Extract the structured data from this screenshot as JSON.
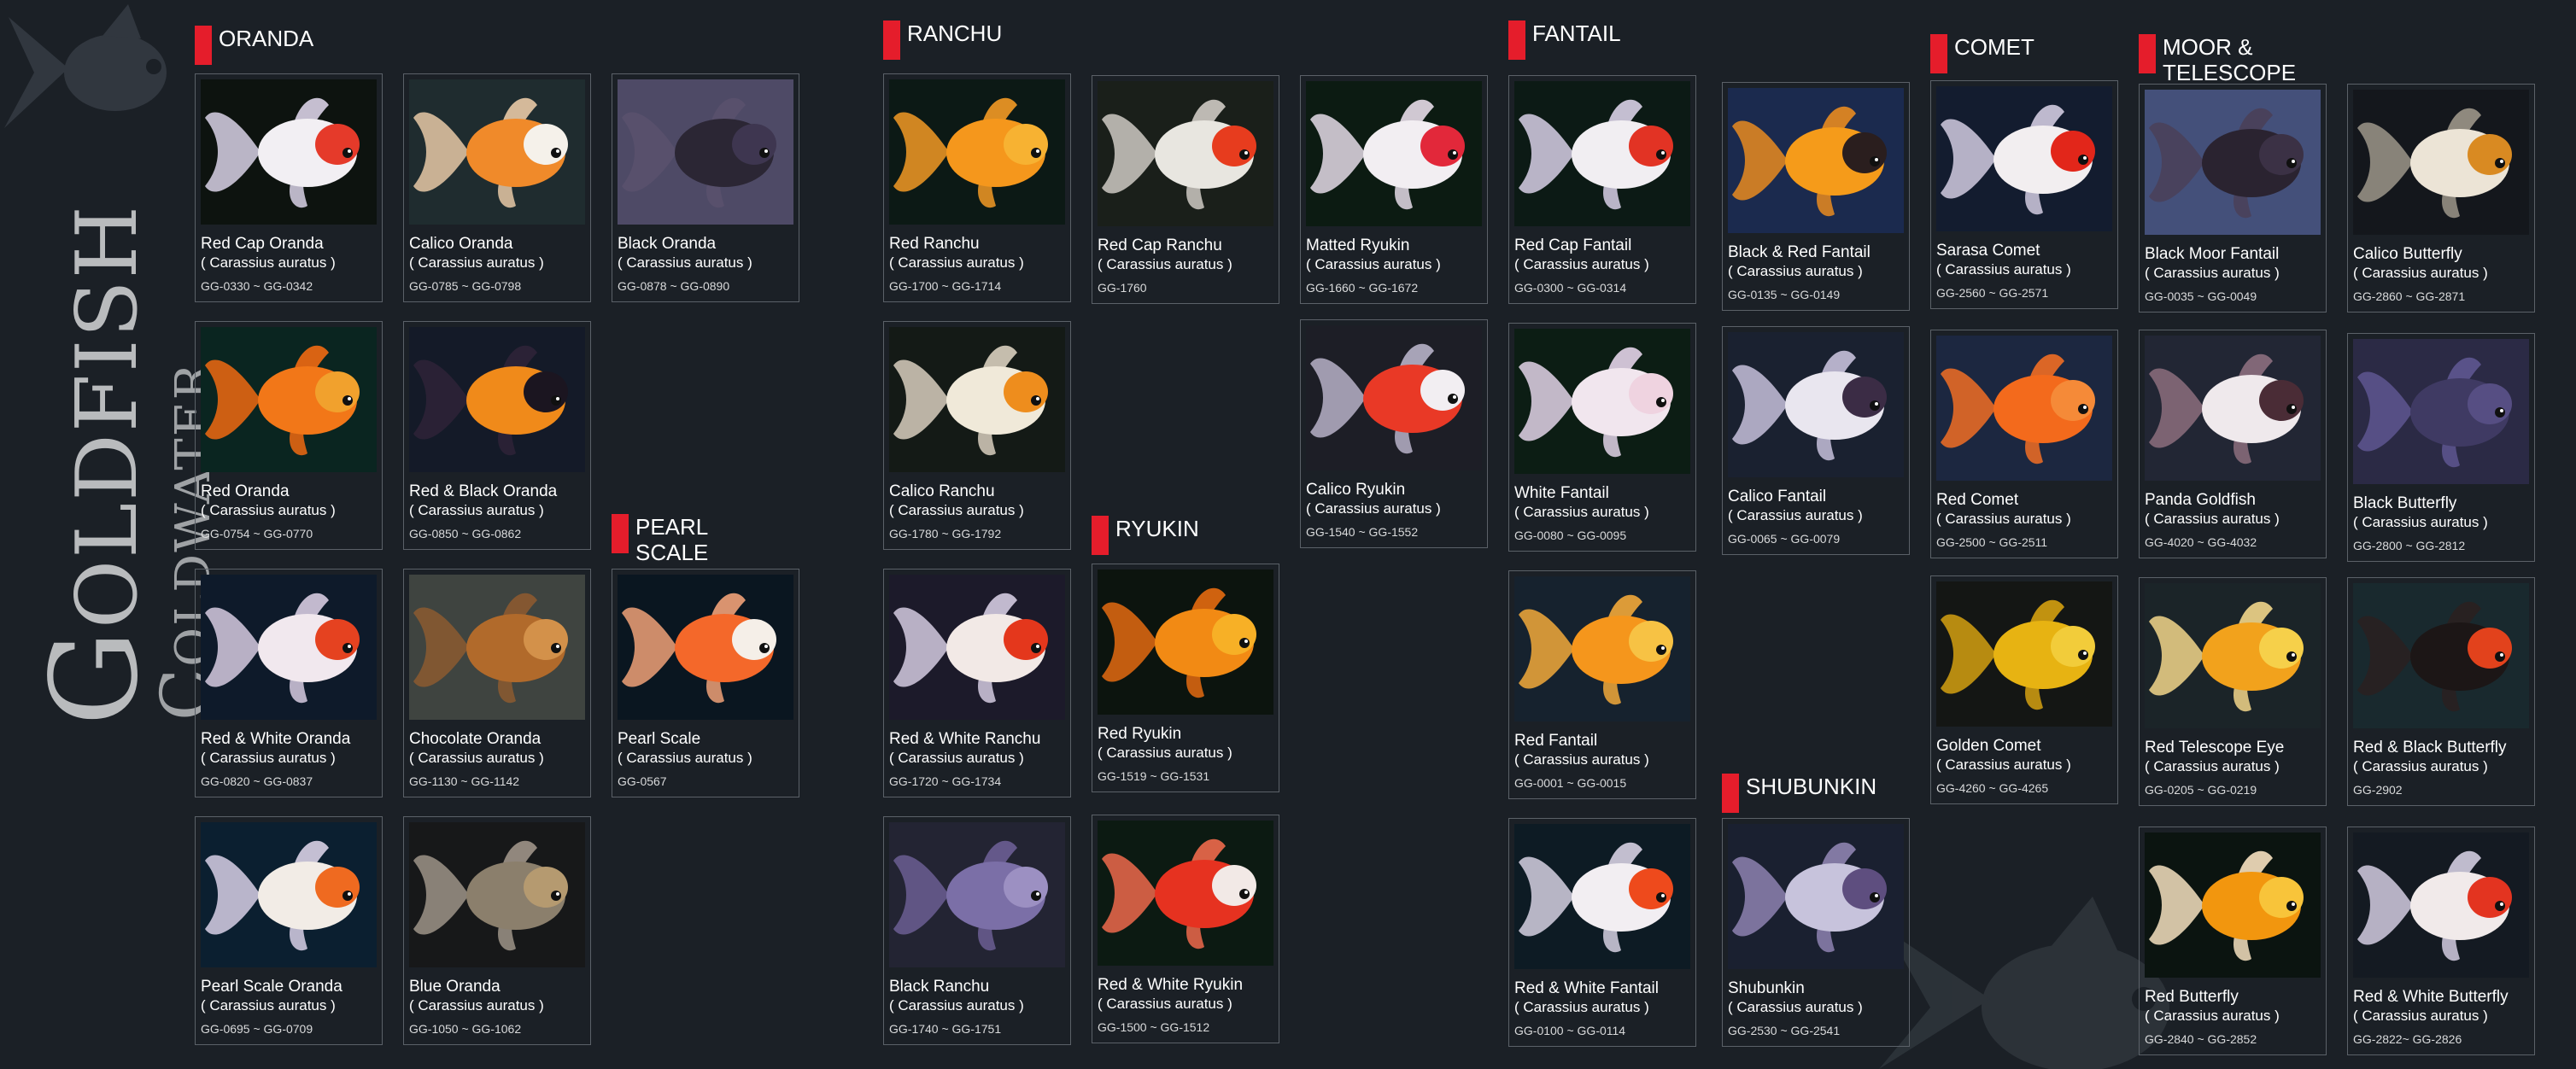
{
  "title": {
    "main": "Goldfish",
    "sub": "Coldwater"
  },
  "theme": {
    "background": "#1b2026",
    "accent": "#e51d2b",
    "card_border": "#5b6168"
  },
  "sections": [
    {
      "id": "oranda",
      "label": "ORANDA"
    },
    {
      "id": "pearl-scale",
      "label": "PEARL\nSCALE"
    },
    {
      "id": "ranchu",
      "label": "RANCHU"
    },
    {
      "id": "ryukin",
      "label": "RYUKIN"
    },
    {
      "id": "fantail",
      "label": "FANTAIL"
    },
    {
      "id": "shubunkin",
      "label": "SHUBUNKIN"
    },
    {
      "id": "comet",
      "label": "COMET"
    },
    {
      "id": "moor-telescope",
      "label": "MOOR &\nTELESCOPE"
    }
  ],
  "fish": [
    {
      "name": "Red Cap Oranda",
      "species": "( Carassius auratus )",
      "code": "GG-0330 ~ GG-0342",
      "photo_bg": "#0d130f",
      "body": "#f2eff3",
      "accent": "#e53a2a",
      "fin": "#d9d2e6"
    },
    {
      "name": "Calico Oranda",
      "species": "( Carassius auratus )",
      "code": "GG-0785 ~ GG-0798",
      "photo_bg": "#1f2c2f",
      "body": "#f08a2a",
      "accent": "#f5f1ea",
      "fin": "#e8c9a6"
    },
    {
      "name": "Black Oranda",
      "species": "( Carassius auratus )",
      "code": "GG-0878 ~ GG-0890",
      "photo_bg": "#4e4a66",
      "body": "#2b2634",
      "accent": "#3e3650",
      "fin": "#5a516d"
    },
    {
      "name": "Red Oranda",
      "species": "( Carassius auratus )",
      "code": "GG-0754 ~ GG-0770",
      "photo_bg": "#0a2520",
      "body": "#f27718",
      "accent": "#f1a12d",
      "fin": "#f06a12"
    },
    {
      "name": "Red & Black Oranda",
      "species": "( Carassius auratus )",
      "code": "GG-0850 ~ GG-0862",
      "photo_bg": "#141a28",
      "body": "#f08a1a",
      "accent": "#1b1520",
      "fin": "#2e2337"
    },
    {
      "name": "Red & White Oranda",
      "species": "( Carassius auratus )",
      "code": "GG-0820 ~ GG-0837",
      "photo_bg": "#0e1a2a",
      "body": "#f1e8ee",
      "accent": "#e54220",
      "fin": "#d6cbe0"
    },
    {
      "name": "Chocolate Oranda",
      "species": "( Carassius auratus )",
      "code": "GG-1130 ~ GG-1142",
      "photo_bg": "#3f4440",
      "body": "#b16a2b",
      "accent": "#d3914a",
      "fin": "#8c5a30"
    },
    {
      "name": "Pearl Scale",
      "species": "( Carassius auratus )",
      "code": "GG-0567",
      "photo_bg": "#0a1620",
      "body": "#f4682a",
      "accent": "#f5efe8",
      "fin": "#f0a178"
    },
    {
      "name": "Pearl Scale Oranda",
      "species": "( Carassius auratus )",
      "code": "GG-0695 ~ GG-0709",
      "photo_bg": "#0b1f30",
      "body": "#f2ece6",
      "accent": "#ef6a20",
      "fin": "#d8d0e6"
    },
    {
      "name": "Blue Oranda",
      "species": "( Carassius auratus )",
      "code": "GG-1050 ~ GG-1062",
      "photo_bg": "#171819",
      "body": "#8b7f6c",
      "accent": "#b59a70",
      "fin": "#9e9488"
    },
    {
      "name": "Red Ranchu",
      "species": "( Carassius auratus )",
      "code": "GG-1700 ~ GG-1714",
      "photo_bg": "#0c1915",
      "body": "#f5971c",
      "accent": "#f7b232",
      "fin": "#f39a25"
    },
    {
      "name": "Red Cap Ranchu",
      "species": "( Carassius auratus )",
      "code": "GG-1760",
      "photo_bg": "#1a1f1a",
      "body": "#e8e6e0",
      "accent": "#e73c1e",
      "fin": "#cfcac4"
    },
    {
      "name": "Matted Ryukin",
      "species": "( Carassius auratus )",
      "code": "GG-1660 ~ GG-1672",
      "photo_bg": "#0c1b12",
      "body": "#f2eef2",
      "accent": "#e2283a",
      "fin": "#e5dbe8"
    },
    {
      "name": "Calico Ranchu",
      "species": "( Carassius auratus )",
      "code": "GG-1780 ~ GG-1792",
      "photo_bg": "#141a16",
      "body": "#f0e9d9",
      "accent": "#ee8d1d",
      "fin": "#d8cfbe"
    },
    {
      "name": "Calico Ryukin",
      "species": "( Carassius auratus )",
      "code": "GG-1540 ~ GG-1552",
      "photo_bg": "#1d1e26",
      "body": "#e93926",
      "accent": "#f2eef2",
      "fin": "#b7b1c8"
    },
    {
      "name": "Red & White Ranchu",
      "species": "( Carassius auratus )",
      "code": "GG-1720 ~ GG-1734",
      "photo_bg": "#1c1a2a",
      "body": "#f2e9e6",
      "accent": "#e4371c",
      "fin": "#d4cbe0"
    },
    {
      "name": "Red Ryukin",
      "species": "( Carassius auratus )",
      "code": "GG-1519 ~ GG-1531",
      "photo_bg": "#0c140e",
      "body": "#f28a14",
      "accent": "#f7b026",
      "fin": "#e46a10"
    },
    {
      "name": "Black Ranchu",
      "species": "( Carassius auratus )",
      "code": "GG-1740 ~ GG-1751",
      "photo_bg": "#232433",
      "body": "#7b6fa7",
      "accent": "#9c90c2",
      "fin": "#6b5e93"
    },
    {
      "name": "Red & White Ryukin",
      "species": "( Carassius auratus )",
      "code": "GG-1500 ~ GG-1512",
      "photo_bg": "#0c1a12",
      "body": "#e63220",
      "accent": "#f2e9e6",
      "fin": "#ee6a4c"
    },
    {
      "name": "Red Cap Fantail",
      "species": "( Carassius auratus )",
      "code": "GG-0300 ~ GG-0314",
      "photo_bg": "#0c1a15",
      "body": "#f1eef2",
      "accent": "#e23324",
      "fin": "#d8d0e6"
    },
    {
      "name": "Black & Red Fantail",
      "species": "( Carassius auratus )",
      "code": "GG-0135 ~ GG-0149",
      "photo_bg": "#1b2a4e",
      "body": "#f59b1a",
      "accent": "#2a1e1e",
      "fin": "#e98b20"
    },
    {
      "name": "White Fantail",
      "species": "( Carassius auratus )",
      "code": "GG-0080 ~ GG-0095",
      "photo_bg": "#0c1d14",
      "body": "#f1e6ee",
      "accent": "#efd3e0",
      "fin": "#e3d4e8"
    },
    {
      "name": "Calico Fantail",
      "species": "( Carassius auratus )",
      "code": "GG-0065 ~ GG-0079",
      "photo_bg": "#1a2130",
      "body": "#e9e6ef",
      "accent": "#3b2c45",
      "fin": "#c7c0da"
    },
    {
      "name": "Red Fantail",
      "species": "( Carassius auratus )",
      "code": "GG-0001 ~ GG-0015",
      "photo_bg": "#16222e",
      "body": "#f5961c",
      "accent": "#f7c244",
      "fin": "#f2a93a"
    },
    {
      "name": "Red & White Fantail",
      "species": "( Carassius auratus )",
      "code": "GG-0100 ~ GG-0114",
      "photo_bg": "#0d1b24",
      "body": "#f2eef2",
      "accent": "#ee4a1c",
      "fin": "#d6d0e2"
    },
    {
      "name": "Shubunkin",
      "species": "( Carassius auratus )",
      "code": "GG-2530 ~ GG-2541",
      "photo_bg": "#1a2030",
      "body": "#c7c3dc",
      "accent": "#5e4e7f",
      "fin": "#8e83b0"
    },
    {
      "name": "Sarasa Comet",
      "species": "( Carassius auratus )",
      "code": "GG-2560 ~ GG-2571",
      "photo_bg": "#131c2f",
      "body": "#f2eef0",
      "accent": "#e2261a",
      "fin": "#d2cbe0"
    },
    {
      "name": "Red Comet",
      "species": "( Carassius auratus )",
      "code": "GG-2500 ~ GG-2511",
      "photo_bg": "#1c2740",
      "body": "#f36a1c",
      "accent": "#f58a38",
      "fin": "#f16e24"
    },
    {
      "name": "Golden Comet",
      "species": "( Carassius auratus )",
      "code": "GG-4260 ~ GG-4265",
      "photo_bg": "#141614",
      "body": "#e7b312",
      "accent": "#f2cc3a",
      "fin": "#d4a010"
    },
    {
      "name": "Black Moor Fantail",
      "species": "( Carassius auratus )",
      "code": "GG-0035 ~ GG-0049",
      "photo_bg": "#44507a",
      "body": "#2a2330",
      "accent": "#3b3145",
      "fin": "#4a3f58"
    },
    {
      "name": "Calico Butterfly",
      "species": "( Carassius auratus )",
      "code": "GG-2860 ~ GG-2871",
      "photo_bg": "#14171c",
      "body": "#ece4d6",
      "accent": "#d98a22",
      "fin": "#9c968a"
    },
    {
      "name": "Panda Goldfish",
      "species": "( Carassius auratus )",
      "code": "GG-4020 ~ GG-4032",
      "photo_bg": "#222634",
      "body": "#efe9ec",
      "accent": "#4a2c36",
      "fin": "#8c6f7e"
    },
    {
      "name": "Black Butterfly",
      "species": "( Carassius auratus )",
      "code": "GG-2800 ~ GG-2812",
      "photo_bg": "#2b2a45",
      "body": "#3f3a63",
      "accent": "#564e83",
      "fin": "#5e5690"
    },
    {
      "name": "Red Telescope Eye",
      "species": "( Carassius auratus )",
      "code": "GG-0205 ~ GG-0219",
      "photo_bg": "#1b2428",
      "body": "#f2a21c",
      "accent": "#f6d04a",
      "fin": "#f2d68a"
    },
    {
      "name": "Red & Black Butterfly",
      "species": "( Carassius auratus )",
      "code": "GG-2902",
      "photo_bg": "#19292e",
      "body": "#1c1616",
      "accent": "#e2421c",
      "fin": "#2a2020"
    },
    {
      "name": "Red Butterfly",
      "species": "( Carassius auratus )",
      "code": "GG-2840 ~ GG-2852",
      "photo_bg": "#0b1410",
      "body": "#f2960e",
      "accent": "#f8c43a",
      "fin": "#f6e0c0"
    },
    {
      "name": "Red & White Butterfly",
      "species": "( Carassius auratus )",
      "code": "GG-2822~ GG-2826",
      "photo_bg": "#141a22",
      "body": "#f1eaea",
      "accent": "#e33420",
      "fin": "#d2cde0"
    }
  ]
}
